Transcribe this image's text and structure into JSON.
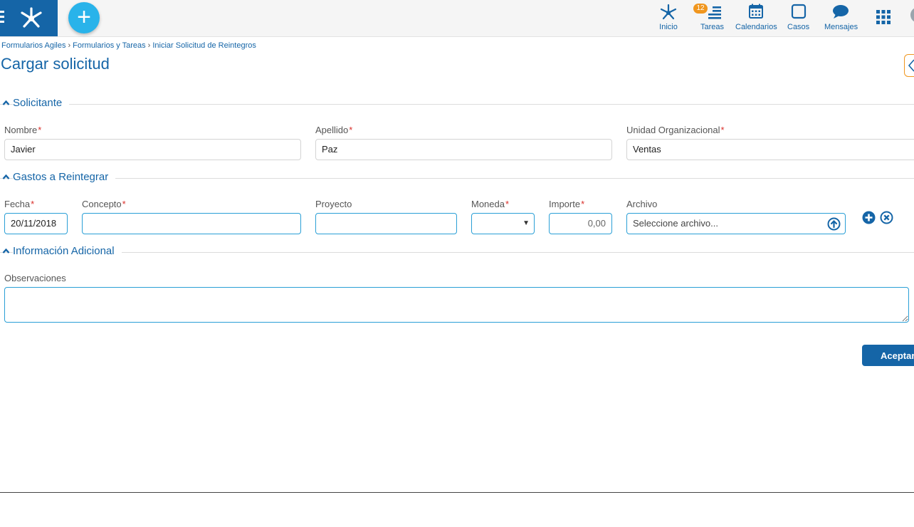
{
  "nav": {
    "inicio": "Inicio",
    "tareas": "Tareas",
    "tareas_badge": "12",
    "calendarios": "Calendarios",
    "casos": "Casos",
    "mensajes": "Mensajes"
  },
  "breadcrumb": {
    "items": [
      "Formularios Agiles",
      "Formularios y Tareas",
      "Iniciar Solicitud de Reintegros"
    ],
    "separator": "›"
  },
  "page": {
    "title": "Cargar solicitud"
  },
  "solicitante": {
    "title": "Solicitante",
    "nombre_label": "Nombre",
    "nombre_value": "Javier",
    "apellido_label": "Apellido",
    "apellido_value": "Paz",
    "unidad_label": "Unidad Organizacional",
    "unidad_value": "Ventas"
  },
  "gastos": {
    "title": "Gastos a Reintegrar",
    "fecha_label": "Fecha",
    "fecha_value": "20/11/2018",
    "concepto_label": "Concepto",
    "concepto_value": "",
    "proyecto_label": "Proyecto",
    "proyecto_value": "",
    "moneda_label": "Moneda",
    "moneda_value": "",
    "moneda_arrow": "▼",
    "importe_label": "Importe",
    "importe_value": "0,00",
    "archivo_label": "Archivo",
    "archivo_placeholder": "Seleccione archivo..."
  },
  "info": {
    "title": "Información Adicional",
    "observaciones_label": "Observaciones",
    "observaciones_value": ""
  },
  "required_mark": "*",
  "actions": {
    "accept_label": "Aceptar"
  },
  "colors": {
    "brand": "#1565a7",
    "accent": "#29b3ea",
    "badge": "#f0961e",
    "required": "#d9302b"
  }
}
